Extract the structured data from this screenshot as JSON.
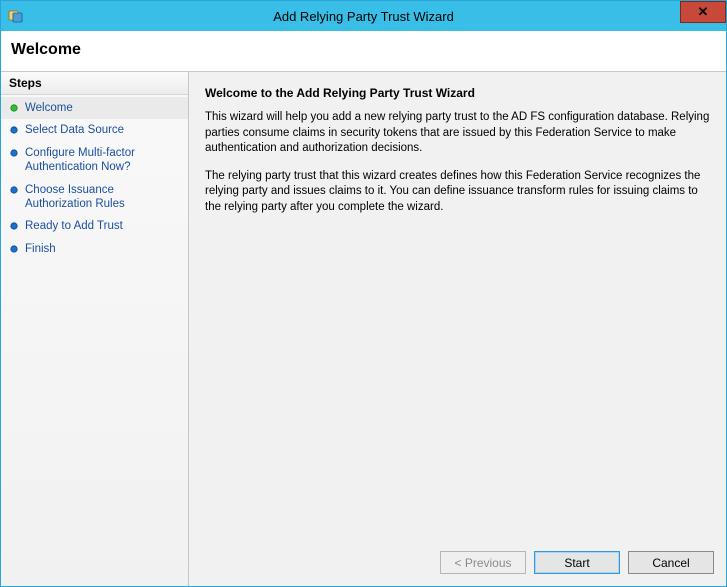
{
  "titlebar": {
    "title": "Add Relying Party Trust Wizard",
    "close": "✕"
  },
  "header": {
    "title": "Welcome"
  },
  "sidebar": {
    "header": "Steps",
    "items": [
      {
        "label": "Welcome",
        "current": true
      },
      {
        "label": "Select Data Source",
        "current": false
      },
      {
        "label": "Configure Multi-factor Authentication Now?",
        "current": false
      },
      {
        "label": "Choose Issuance Authorization Rules",
        "current": false
      },
      {
        "label": "Ready to Add Trust",
        "current": false
      },
      {
        "label": "Finish",
        "current": false
      }
    ]
  },
  "content": {
    "heading": "Welcome to the Add Relying Party Trust Wizard",
    "para1": "This wizard will help you add a new relying party trust to the AD FS configuration database.  Relying parties consume claims in security tokens that are issued by this Federation Service to make authentication and authorization decisions.",
    "para2": "The relying party trust that this wizard creates defines how this Federation Service recognizes the relying party and issues claims to it. You can define issuance transform rules for issuing claims to the relying party after you complete the wizard."
  },
  "footer": {
    "previous": "< Previous",
    "start": "Start",
    "cancel": "Cancel"
  },
  "colors": {
    "titlebar": "#39bee8",
    "close": "#c8483a",
    "link": "#1a4f9c",
    "current_bullet": "#2fbf3a",
    "pending_bullet": "#1a73c9"
  }
}
